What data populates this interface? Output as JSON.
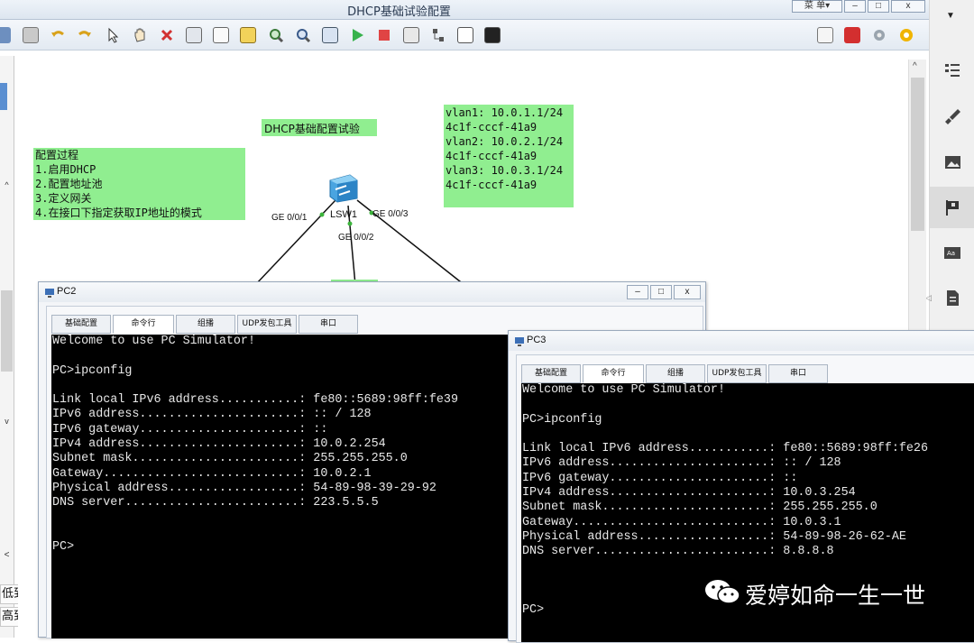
{
  "window": {
    "title": "DHCP基础试验配置",
    "menu_label": "菜 单▾",
    "minimize": "–",
    "maximize": "□",
    "close": "x"
  },
  "toolbar": {
    "icons": [
      "save-icon",
      "print-icon",
      "undo-icon",
      "redo-icon",
      "select-icon",
      "hand-icon",
      "delete-icon",
      "clear-icon",
      "text-icon",
      "rectangle-icon",
      "zoom-in-icon",
      "zoom-out-icon",
      "fit-icon",
      "start-icon",
      "stop-icon",
      "capture-icon",
      "topology-icon",
      "grid-icon",
      "console-icon"
    ],
    "right_icons": [
      "chat-icon",
      "huawei-icon",
      "settings-icon",
      "help-icon"
    ]
  },
  "side_panel": {
    "icons": [
      "list-icon",
      "brush-icon",
      "image-icon",
      "flag-icon",
      "text-style-icon",
      "document-icon"
    ]
  },
  "left_panel": {
    "sort_low_high": "低到高",
    "sort_high_low": "高到低"
  },
  "topology": {
    "title_note": "DHCP基础配置试验",
    "steps": [
      "配置过程",
      "1.启用DHCP",
      "2.配置地址池",
      "3.定义网关",
      "4.在接口下指定获取IP地址的模式"
    ],
    "vlan_note": [
      "vlan1: 10.0.1.1/24",
      "4c1f-cccf-41a9",
      "vlan2: 10.0.2.1/24",
      "4c1f-cccf-41a9",
      "vlan3: 10.0.3.1/24",
      "4c1f-cccf-41a9"
    ],
    "switch_label": "LSW1",
    "ports": {
      "p1": "GE 0/0/1",
      "p2": "GE 0/0/2",
      "p3": "GE 0/0/3"
    },
    "colors": {
      "note": "#90ee90",
      "link": "#111111",
      "port_dot": "#3cb43c"
    }
  },
  "pc2": {
    "title": "PC2",
    "tabs": [
      "基础配置",
      "命令行",
      "组播",
      "UDP发包工具",
      "串口"
    ],
    "active_tab": "命令行",
    "terminal": "Welcome to use PC Simulator!\n\nPC>ipconfig\n\nLink local IPv6 address...........: fe80::5689:98ff:fe39\nIPv6 address......................: :: / 128\nIPv6 gateway......................: ::\nIPv4 address......................: 10.0.2.254\nSubnet mask.......................: 255.255.255.0\nGateway...........................: 10.0.2.1\nPhysical address..................: 54-89-98-39-29-92\nDNS server........................: 223.5.5.5\n\n\nPC>"
  },
  "pc3": {
    "title": "PC3",
    "tabs": [
      "基础配置",
      "命令行",
      "组播",
      "UDP发包工具",
      "串口"
    ],
    "active_tab": "命令行",
    "terminal": "Welcome to use PC Simulator!\n\nPC>ipconfig\n\nLink local IPv6 address...........: fe80::5689:98ff:fe26\nIPv6 address......................: :: / 128\nIPv6 gateway......................: ::\nIPv4 address......................: 10.0.3.254\nSubnet mask.......................: 255.255.255.0\nGateway...........................: 10.0.3.1\nPhysical address..................: 54-89-98-26-62-AE\nDNS server........................: 8.8.8.8\n\n\n\nPC>"
  },
  "watermark": "爱婷如命一生一世"
}
